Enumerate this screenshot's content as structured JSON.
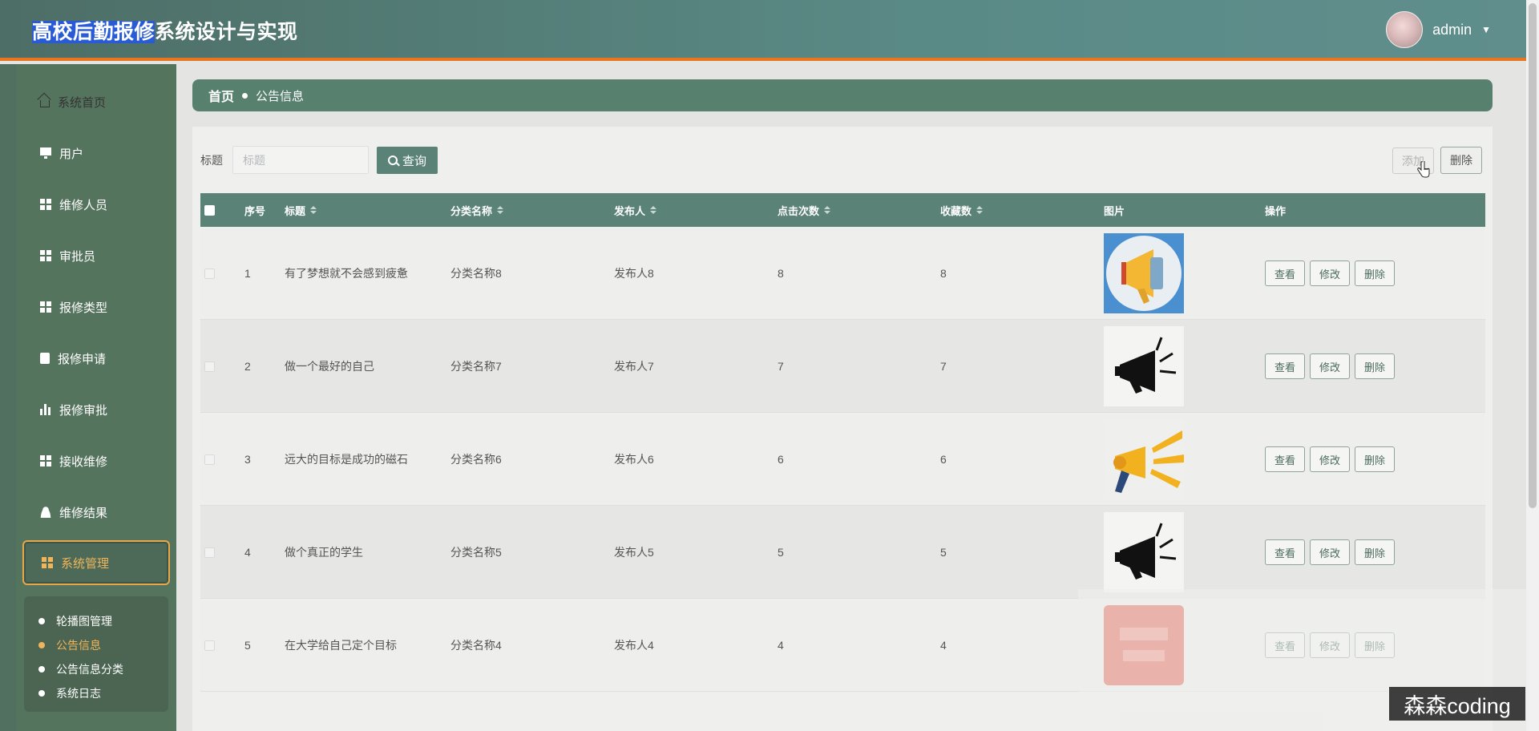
{
  "header": {
    "title_highlighted": "高校后勤报修",
    "title_rest": "系统设计与实现",
    "username": "admin"
  },
  "sidebar": {
    "items": [
      {
        "label": "系统首页",
        "icon": "home-icon"
      },
      {
        "label": "用户",
        "icon": "monitor-icon"
      },
      {
        "label": "维修人员",
        "icon": "grid-icon"
      },
      {
        "label": "审批员",
        "icon": "grid-icon"
      },
      {
        "label": "报修类型",
        "icon": "grid-icon"
      },
      {
        "label": "报修申请",
        "icon": "clipboard-icon"
      },
      {
        "label": "报修审批",
        "icon": "bar-chart-icon"
      },
      {
        "label": "接收维修",
        "icon": "grid-icon"
      },
      {
        "label": "维修结果",
        "icon": "user-icon"
      },
      {
        "label": "系统管理",
        "icon": "grid-icon"
      }
    ],
    "active_item": "系统管理",
    "submenu": [
      "轮播图管理",
      "公告信息",
      "公告信息分类",
      "系统日志"
    ],
    "active_submenu": "公告信息"
  },
  "breadcrumb": {
    "home": "首页",
    "current": "公告信息"
  },
  "search": {
    "label": "标题",
    "placeholder": "标题",
    "query_label": "查询"
  },
  "toolbar": {
    "add_label": "添加",
    "delete_label": "删除"
  },
  "table": {
    "columns": [
      "序号",
      "标题",
      "分类名称",
      "发布人",
      "点击次数",
      "收藏数",
      "图片",
      "操作"
    ],
    "actions": [
      "查看",
      "修改",
      "删除"
    ],
    "rows": [
      {
        "index": "1",
        "title": "有了梦想就不会感到疲惫",
        "category": "分类名称8",
        "publisher": "发布人8",
        "clicks": "8",
        "favorites": "8",
        "image": "megaphone-blue-circle"
      },
      {
        "index": "2",
        "title": "做一个最好的自己",
        "category": "分类名称7",
        "publisher": "发布人7",
        "clicks": "7",
        "favorites": "7",
        "image": "megaphone-black"
      },
      {
        "index": "3",
        "title": "远大的目标是成功的磁石",
        "category": "分类名称6",
        "publisher": "发布人6",
        "clicks": "6",
        "favorites": "6",
        "image": "megaphone-yellow"
      },
      {
        "index": "4",
        "title": "做个真正的学生",
        "category": "分类名称5",
        "publisher": "发布人5",
        "clicks": "5",
        "favorites": "5",
        "image": "megaphone-black"
      },
      {
        "index": "5",
        "title": "在大学给自己定个目标",
        "category": "分类名称4",
        "publisher": "发布人4",
        "clicks": "4",
        "favorites": "4",
        "image": "red-banner"
      }
    ]
  },
  "watermark": "森森coding",
  "colors": {
    "header": "#5a8a86",
    "accent_orange": "#e8761f",
    "sidebar": "#55745e",
    "table_header": "#5a8276",
    "active": "#f0b55a"
  }
}
